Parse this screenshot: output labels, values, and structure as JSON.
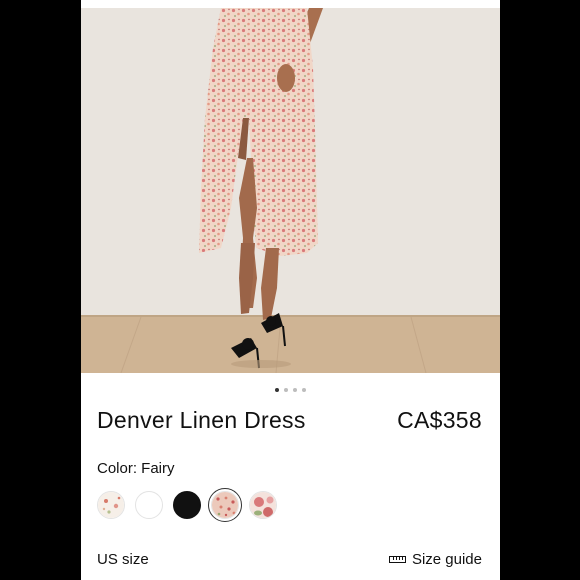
{
  "product": {
    "name": "Denver Linen Dress",
    "price": "CA$358",
    "color_label": "Color: Fairy",
    "swatches": [
      {
        "name": "white-floral",
        "color": "#f6efe8"
      },
      {
        "name": "white",
        "color": "#ffffff"
      },
      {
        "name": "black",
        "color": "#111111"
      },
      {
        "name": "fairy-pink-floral",
        "color": "#e8c2b4",
        "selected": true
      },
      {
        "name": "rose-print",
        "color": "#d98a8a"
      }
    ],
    "size_label": "US size",
    "size_guide_label": "Size guide",
    "size_guide_icon": "ruler-icon"
  },
  "carousel": {
    "count": 4,
    "active_index": 0
  },
  "colors": {
    "background": "#ffffff",
    "text": "#111111",
    "photo_wall": "#e9e4de",
    "photo_floor": "#cfb494"
  }
}
